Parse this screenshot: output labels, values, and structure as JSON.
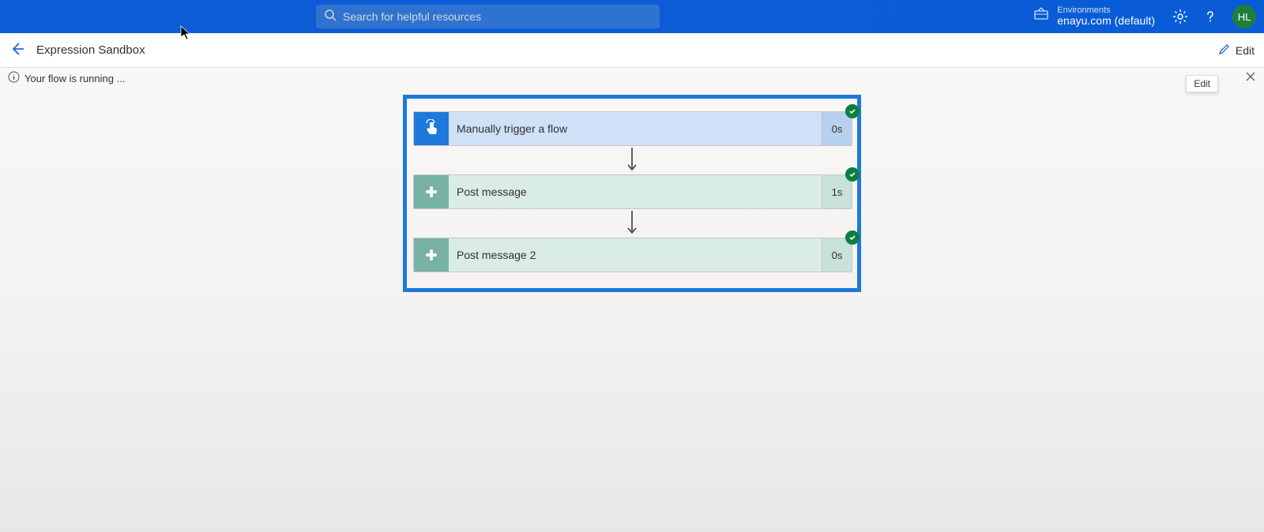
{
  "header": {
    "search_placeholder": "Search for helpful resources",
    "env_label": "Environments",
    "env_value": "enayu.com (default)",
    "avatar_initials": "HL"
  },
  "subbar": {
    "page_title": "Expression Sandbox",
    "edit_label": "Edit"
  },
  "status": {
    "message": "Your flow is running ..."
  },
  "tooltip": {
    "edit": "Edit"
  },
  "flow": {
    "steps": [
      {
        "title": "Manually trigger a flow",
        "duration": "0s",
        "type": "trigger"
      },
      {
        "title": "Post message",
        "duration": "1s",
        "type": "slack"
      },
      {
        "title": "Post message 2",
        "duration": "0s",
        "type": "slack"
      }
    ]
  }
}
